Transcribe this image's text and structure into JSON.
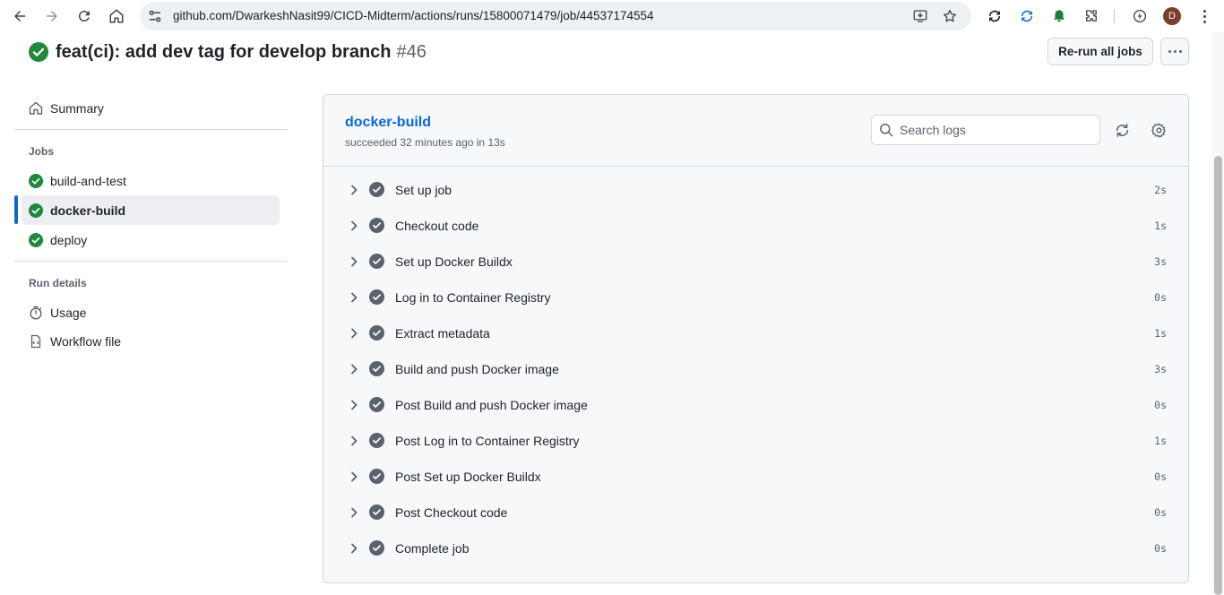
{
  "browser": {
    "url": "github.com/DwarkeshNasit99/CICD-Midterm/actions/runs/15800071479/job/44537174554",
    "avatar_letter": "D"
  },
  "run": {
    "title": "feat(ci): add dev tag for develop branch",
    "number": "#46",
    "rerun_label": "Re-run all jobs",
    "status_color": "#1f883d"
  },
  "sidebar": {
    "summary_label": "Summary",
    "jobs_heading": "Jobs",
    "jobs": [
      {
        "label": "build-and-test",
        "active": false
      },
      {
        "label": "docker-build",
        "active": true
      },
      {
        "label": "deploy",
        "active": false
      }
    ],
    "run_details_heading": "Run details",
    "usage_label": "Usage",
    "workflow_label": "Workflow file"
  },
  "job": {
    "name": "docker-build",
    "meta": "succeeded 32 minutes ago in 13s",
    "search_placeholder": "Search logs",
    "steps": [
      {
        "name": "Set up job",
        "duration": "2s"
      },
      {
        "name": "Checkout code",
        "duration": "1s"
      },
      {
        "name": "Set up Docker Buildx",
        "duration": "3s"
      },
      {
        "name": "Log in to Container Registry",
        "duration": "0s"
      },
      {
        "name": "Extract metadata",
        "duration": "1s"
      },
      {
        "name": "Build and push Docker image",
        "duration": "3s"
      },
      {
        "name": "Post Build and push Docker image",
        "duration": "0s"
      },
      {
        "name": "Post Log in to Container Registry",
        "duration": "1s"
      },
      {
        "name": "Post Set up Docker Buildx",
        "duration": "0s"
      },
      {
        "name": "Post Checkout code",
        "duration": "0s"
      },
      {
        "name": "Complete job",
        "duration": "0s"
      }
    ]
  },
  "colors": {
    "accent": "#0969da",
    "success": "#1f883d",
    "step_check": "#59636e"
  }
}
